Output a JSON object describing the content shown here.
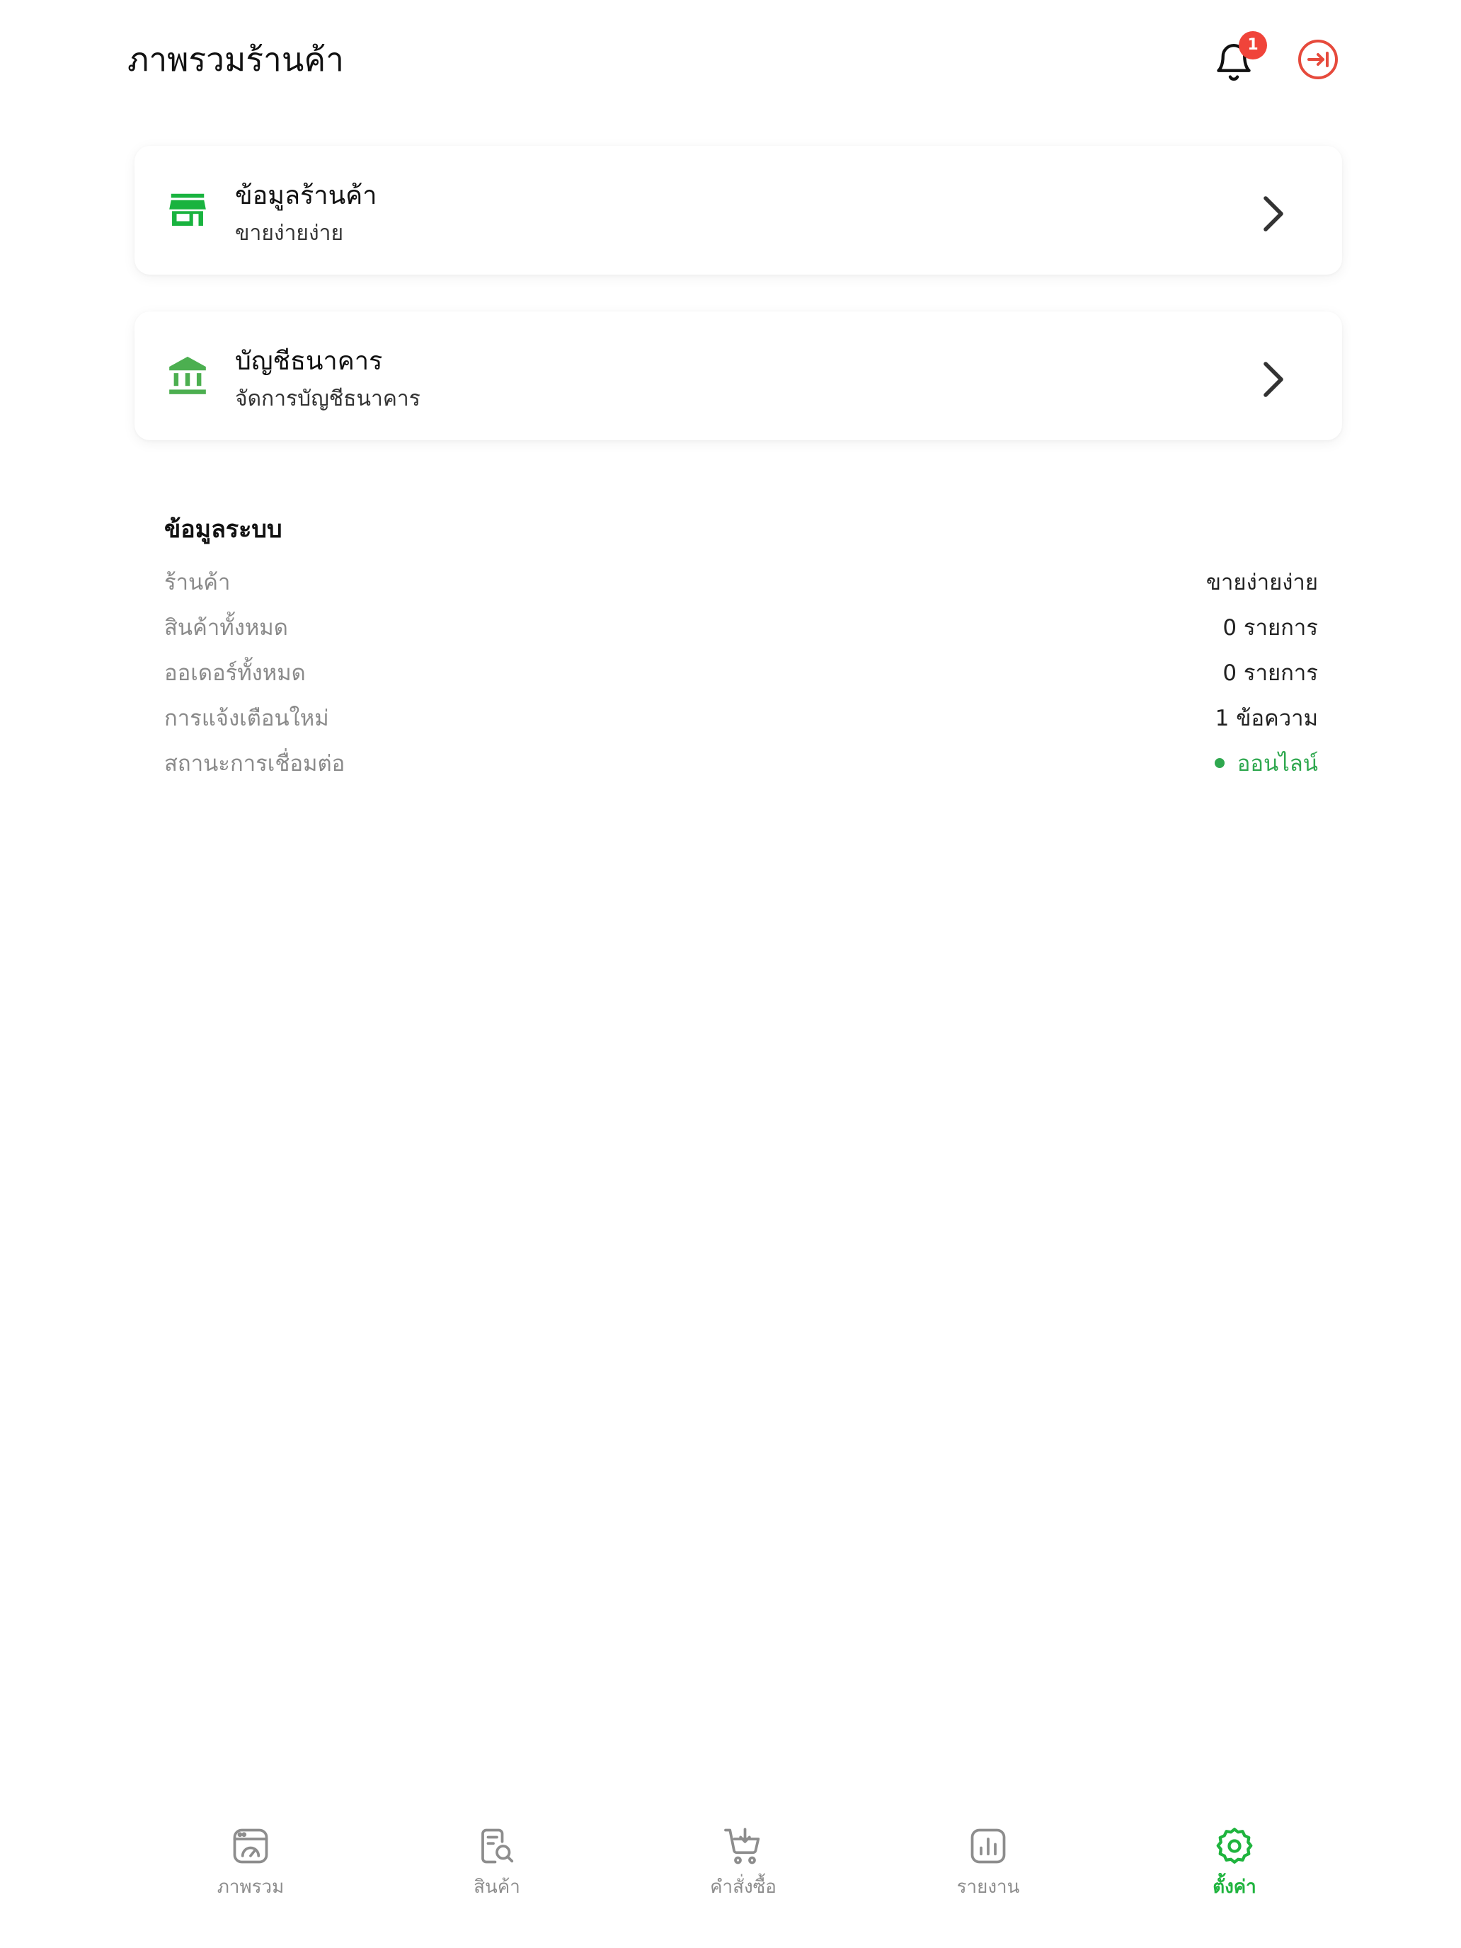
{
  "header": {
    "title": "ภาพรวมร้านค้า",
    "notification_count": "1"
  },
  "cards": {
    "store": {
      "title": "ข้อมูลร้านค้า",
      "subtitle": "ขายง่ายง่าย"
    },
    "bank": {
      "title": "บัญชีธนาคาร",
      "subtitle": "จัดการบัญชีธนาคาร"
    }
  },
  "system_info": {
    "heading": "ข้อมูลระบบ",
    "rows": [
      {
        "label": "ร้านค้า",
        "value": "ขายง่ายง่าย"
      },
      {
        "label": "สินค้าทั้งหมด",
        "value": "0 รายการ"
      },
      {
        "label": "ออเดอร์ทั้งหมด",
        "value": "0 รายการ"
      },
      {
        "label": "การแจ้งเตือนใหม่",
        "value": "1 ข้อความ"
      },
      {
        "label": "สถานะการเชื่อมต่อ",
        "value": "ออนไลน์"
      }
    ]
  },
  "bottom_nav": {
    "items": [
      {
        "label": "ภาพรวม",
        "icon": "dashboard-icon"
      },
      {
        "label": "สินค้า",
        "icon": "product-search-icon"
      },
      {
        "label": "คำสั่งซื้อ",
        "icon": "cart-icon"
      },
      {
        "label": "รายงาน",
        "icon": "chart-icon"
      },
      {
        "label": "ตั้งค่า",
        "icon": "gear-icon"
      }
    ],
    "active_index": 4
  },
  "colors": {
    "accent_green": "#1fb43e",
    "store_icon_green": "#19b33f",
    "bank_icon_green": "#4caf50",
    "online_green": "#2fa84f",
    "logout_red": "#e64a3c",
    "badge_red": "#f0443a",
    "muted_gray": "#8a8a8a"
  }
}
